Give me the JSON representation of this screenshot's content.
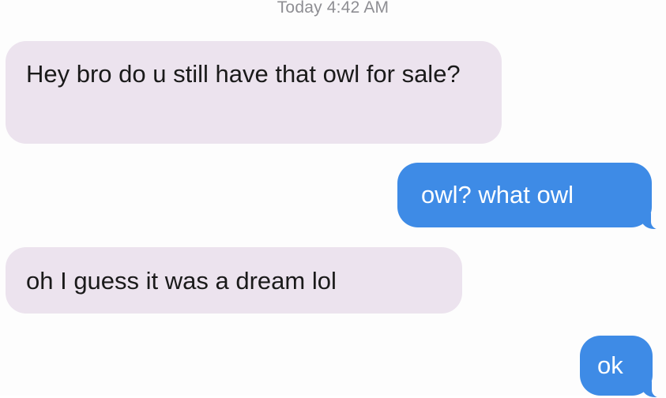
{
  "thread": {
    "timestamp": "Today 4:42 AM",
    "messages": [
      {
        "direction": "incoming",
        "text": "Hey bro do u still have that owl for sale?"
      },
      {
        "direction": "outgoing",
        "text": "owl? what owl"
      },
      {
        "direction": "incoming",
        "text": "oh I guess it was a dream lol"
      },
      {
        "direction": "outgoing",
        "text": "ok"
      }
    ]
  },
  "colors": {
    "incoming_bubble": "#ece3ee",
    "outgoing_bubble": "#3e8be6",
    "timestamp_text": "#8e8e93"
  }
}
